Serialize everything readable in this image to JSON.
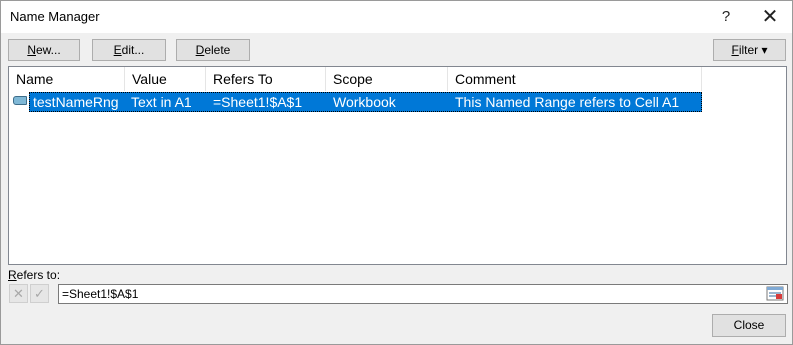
{
  "window": {
    "title": "Name Manager",
    "help_glyph": "?",
    "close_glyph": "✕"
  },
  "toolbar": {
    "new_prefix": "",
    "new_ul": "N",
    "new_rest": "ew...",
    "edit_ul": "E",
    "edit_rest": "dit...",
    "delete_ul": "D",
    "delete_rest": "elete",
    "filter_ul": "F",
    "filter_rest": "ilter ▾"
  },
  "table": {
    "columns": [
      "Name",
      "Value",
      "Refers To",
      "Scope",
      "Comment"
    ],
    "rows": [
      {
        "name": "testNameRng",
        "value": "Text in A1",
        "refers_to": "=Sheet1!$A$1",
        "scope": "Workbook",
        "comment": "This Named Range refers to Cell A1",
        "icon": "named-range-icon",
        "selected": true
      }
    ]
  },
  "refers": {
    "label_ul": "R",
    "label_rest": "efers to:",
    "value": "=Sheet1!$A$1",
    "cancel_glyph": "✕",
    "confirm_glyph": "✓"
  },
  "footer": {
    "close_label": "Close"
  },
  "colors": {
    "selection": "#0078d7",
    "dialog_bg": "#f0f0f0"
  }
}
